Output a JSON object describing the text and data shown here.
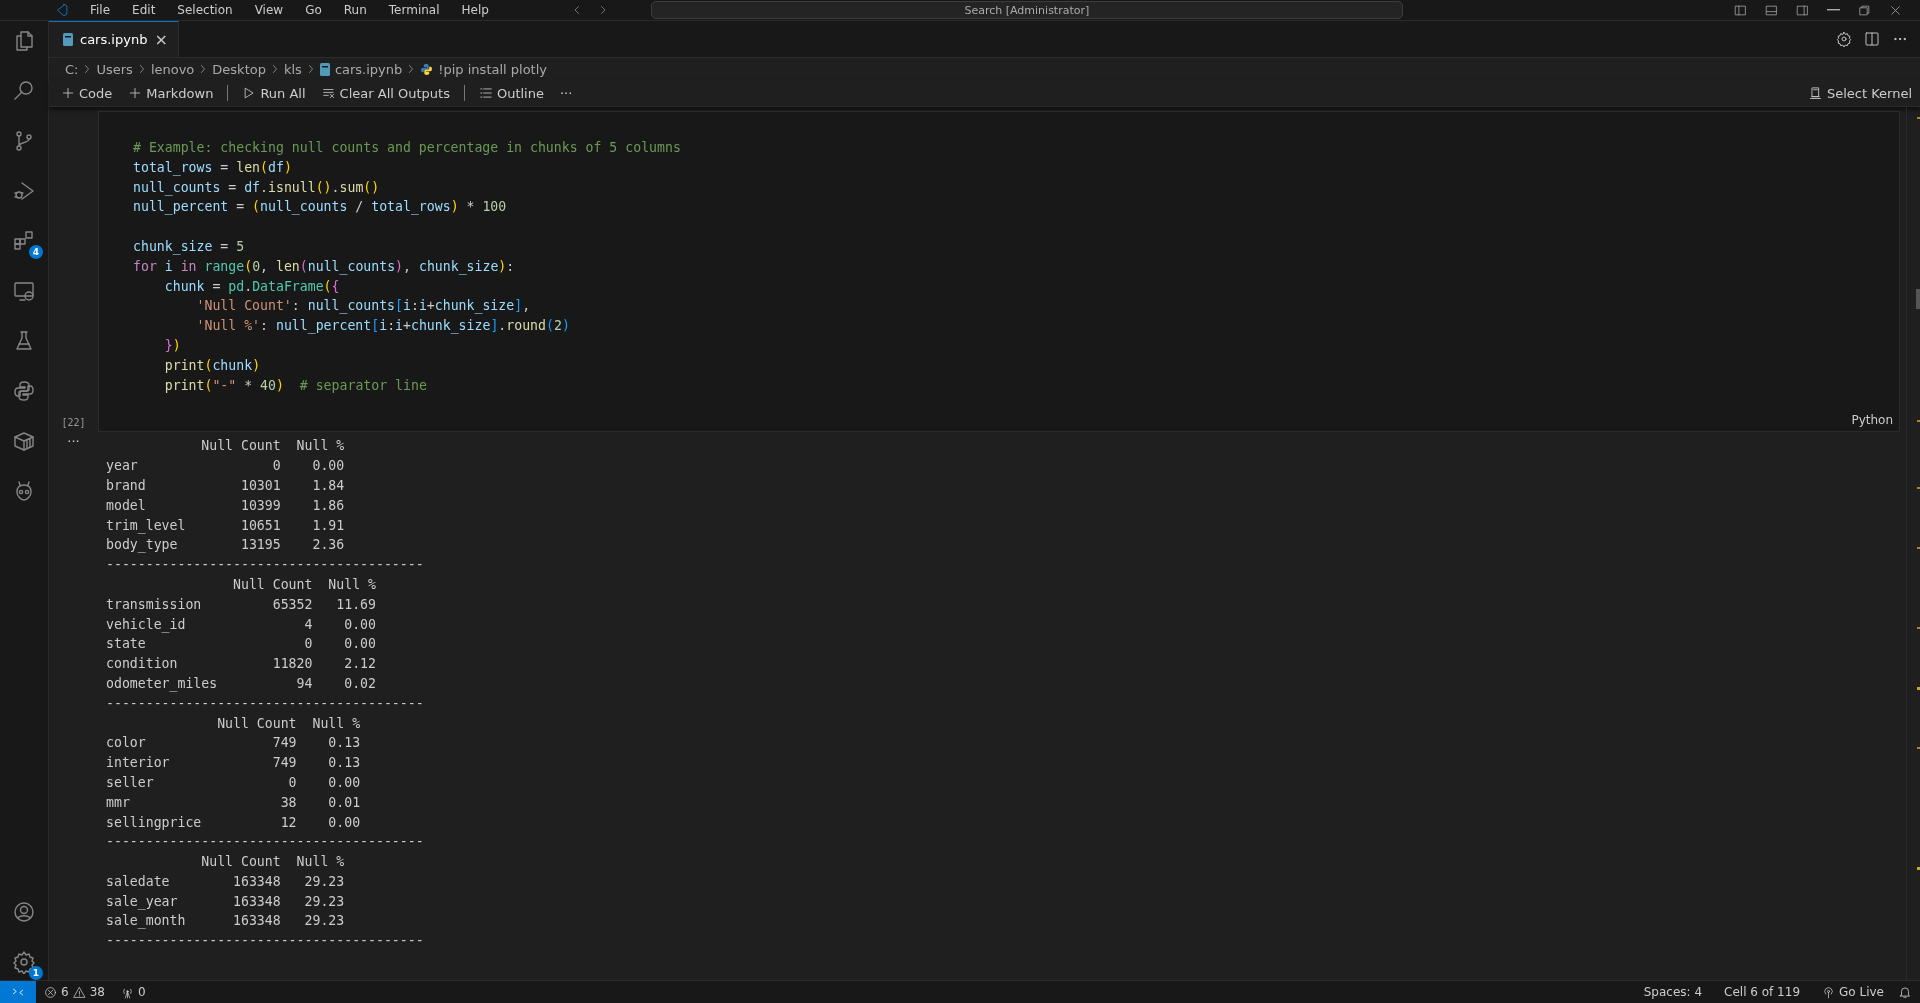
{
  "menu_bar": {
    "items": [
      "File",
      "Edit",
      "Selection",
      "View",
      "Go",
      "Run",
      "Terminal",
      "Help"
    ],
    "search": {
      "value": "Search [Administrator]"
    }
  },
  "activity_bar": {
    "top": [
      {
        "kind": "files"
      },
      {
        "kind": "search"
      },
      {
        "kind": "source-control"
      },
      {
        "kind": "run-debug"
      },
      {
        "kind": "extensions",
        "badge": "4"
      },
      {
        "kind": "remote"
      },
      {
        "kind": "testing"
      },
      {
        "kind": "python"
      },
      {
        "kind": "container"
      },
      {
        "kind": "alien"
      }
    ],
    "bottom": [
      {
        "kind": "account"
      },
      {
        "kind": "manage",
        "badge": "1"
      }
    ]
  },
  "tabs": [
    {
      "label": "cars.ipynb",
      "selected": true,
      "close": "×"
    }
  ],
  "breadcrumbs": [
    {
      "kind": "path",
      "label": "C:"
    },
    {
      "kind": "path",
      "label": "Users"
    },
    {
      "kind": "path",
      "label": "lenovo"
    },
    {
      "kind": "path",
      "label": "Desktop"
    },
    {
      "kind": "path",
      "label": "kls"
    },
    {
      "kind": "notebook",
      "label": "cars.ipynb"
    },
    {
      "kind": "python",
      "label": "!pip install plotly"
    }
  ],
  "toolbar": {
    "items": [
      {
        "kind": "add",
        "label": "Code"
      },
      {
        "kind": "add",
        "label": "Markdown"
      },
      {
        "kind": "run",
        "label": "Run All"
      },
      {
        "kind": "clear",
        "label": "Clear All Outputs"
      },
      {
        "kind": "outline",
        "label": "Outline"
      },
      {
        "kind": "more",
        "label": "···"
      }
    ],
    "kernel": "Select Kernel"
  },
  "cell": {
    "execution_count": "[22]",
    "language": "Python",
    "code": [
      [
        [
          {
            "kind": "comment",
            "text": "# Example: checking null counts and percentage in chunks of 5 columns"
          }
        ],
        [
          {
            "kind": "var",
            "text": "total_rows"
          },
          {
            "kind": "plain",
            "text": " = "
          },
          {
            "kind": "func",
            "text": "len"
          },
          {
            "kind": "bracket1",
            "text": "("
          },
          {
            "kind": "var",
            "text": "df"
          },
          {
            "kind": "bracket1",
            "text": ")"
          }
        ],
        [
          {
            "kind": "var",
            "text": "null_counts"
          },
          {
            "kind": "plain",
            "text": " = "
          },
          {
            "kind": "var",
            "text": "df"
          },
          {
            "kind": "plain",
            "text": "."
          },
          {
            "kind": "func",
            "text": "isnull"
          },
          {
            "kind": "bracket1",
            "text": "()"
          },
          {
            "kind": "plain",
            "text": "."
          },
          {
            "kind": "func",
            "text": "sum"
          },
          {
            "kind": "bracket1",
            "text": "()"
          }
        ],
        [
          {
            "kind": "var",
            "text": "null_percent"
          },
          {
            "kind": "plain",
            "text": " = "
          },
          {
            "kind": "bracket1",
            "text": "("
          },
          {
            "kind": "var",
            "text": "null_counts"
          },
          {
            "kind": "plain",
            "text": " / "
          },
          {
            "kind": "var",
            "text": "total_rows"
          },
          {
            "kind": "bracket1",
            "text": ")"
          },
          {
            "kind": "plain",
            "text": " * "
          },
          {
            "kind": "number",
            "text": "100"
          }
        ]
      ],
      [
        [
          {
            "kind": "var",
            "text": "chunk_size"
          },
          {
            "kind": "plain",
            "text": " = "
          },
          {
            "kind": "number",
            "text": "5"
          }
        ],
        [
          {
            "kind": "keyword",
            "text": "for "
          },
          {
            "kind": "var",
            "text": "i "
          },
          {
            "kind": "keyword",
            "text": "in "
          },
          {
            "kind": "class",
            "text": "range"
          },
          {
            "kind": "bracket1",
            "text": "("
          },
          {
            "kind": "number",
            "text": "0"
          },
          {
            "kind": "plain",
            "text": ", "
          },
          {
            "kind": "func",
            "text": "len"
          },
          {
            "kind": "bracket2",
            "text": "("
          },
          {
            "kind": "var",
            "text": "null_counts"
          },
          {
            "kind": "bracket2",
            "text": ")"
          },
          {
            "kind": "plain",
            "text": ", "
          },
          {
            "kind": "var",
            "text": "chunk_size"
          },
          {
            "kind": "bracket1",
            "text": ")"
          },
          {
            "kind": "plain",
            "text": ":"
          }
        ],
        [
          {
            "kind": "var",
            "text": "    chunk"
          },
          {
            "kind": "plain",
            "text": " = "
          },
          {
            "kind": "class",
            "text": "pd"
          },
          {
            "kind": "plain",
            "text": "."
          },
          {
            "kind": "class",
            "text": "DataFrame"
          },
          {
            "kind": "bracket1",
            "text": "("
          },
          {
            "kind": "bracket2",
            "text": "{"
          }
        ],
        [
          {
            "kind": "string",
            "text": "        'Null Count'"
          },
          {
            "kind": "plain",
            "text": ": "
          },
          {
            "kind": "var",
            "text": "null_counts"
          },
          {
            "kind": "bracket3",
            "text": "["
          },
          {
            "kind": "var",
            "text": "i"
          },
          {
            "kind": "plain",
            "text": ":"
          },
          {
            "kind": "var",
            "text": "i"
          },
          {
            "kind": "plain",
            "text": "+"
          },
          {
            "kind": "var",
            "text": "chunk_size"
          },
          {
            "kind": "bracket3",
            "text": "]"
          },
          {
            "kind": "plain",
            "text": ","
          }
        ],
        [
          {
            "kind": "string",
            "text": "        'Null %'"
          },
          {
            "kind": "plain",
            "text": ": "
          },
          {
            "kind": "var",
            "text": "null_percent"
          },
          {
            "kind": "bracket3",
            "text": "["
          },
          {
            "kind": "var",
            "text": "i"
          },
          {
            "kind": "plain",
            "text": ":"
          },
          {
            "kind": "var",
            "text": "i"
          },
          {
            "kind": "plain",
            "text": "+"
          },
          {
            "kind": "var",
            "text": "chunk_size"
          },
          {
            "kind": "bracket3",
            "text": "]"
          },
          {
            "kind": "plain",
            "text": "."
          },
          {
            "kind": "func",
            "text": "round"
          },
          {
            "kind": "bracket3",
            "text": "("
          },
          {
            "kind": "number",
            "text": "2"
          },
          {
            "kind": "bracket3",
            "text": ")"
          }
        ],
        [
          {
            "kind": "bracket2",
            "text": "    }"
          },
          {
            "kind": "bracket1",
            "text": ")"
          }
        ],
        [
          {
            "kind": "func",
            "text": "    print"
          },
          {
            "kind": "bracket1",
            "text": "("
          },
          {
            "kind": "var",
            "text": "chunk"
          },
          {
            "kind": "bracket1",
            "text": ")"
          }
        ],
        [
          {
            "kind": "func",
            "text": "    print"
          },
          {
            "kind": "bracket1",
            "text": "("
          },
          {
            "kind": "string",
            "text": "\"-\""
          },
          {
            "kind": "plain",
            "text": " * "
          },
          {
            "kind": "number",
            "text": "40"
          },
          {
            "kind": "bracket1",
            "text": ")"
          },
          {
            "kind": "comment",
            "text": "  # separator line"
          }
        ]
      ]
    ]
  },
  "output": {
    "more": "···",
    "tables": [
      {
        "columns": [
          "Null Count",
          "Null %"
        ],
        "separator": "----------------------------------------",
        "rows": [
          {
            "label": "year",
            "count": "0",
            "percent": "0.00"
          },
          {
            "label": "brand",
            "count": "10301",
            "percent": "1.84"
          },
          {
            "label": "model",
            "count": "10399",
            "percent": "1.86"
          },
          {
            "label": "trim_level",
            "count": "10651",
            "percent": "1.91"
          },
          {
            "label": "body_type",
            "count": "13195",
            "percent": "2.36"
          }
        ]
      },
      {
        "columns": [
          "Null Count",
          "Null %"
        ],
        "separator": "----------------------------------------",
        "rows": [
          {
            "label": "transmission",
            "count": "65352",
            "percent": "11.69"
          },
          {
            "label": "vehicle_id",
            "count": "4",
            "percent": "0.00"
          },
          {
            "label": "state",
            "count": "0",
            "percent": "0.00"
          },
          {
            "label": "condition",
            "count": "11820",
            "percent": "2.12"
          },
          {
            "label": "odometer_miles",
            "count": "94",
            "percent": "0.02"
          }
        ]
      },
      {
        "columns": [
          "Null Count",
          "Null %"
        ],
        "separator": "----------------------------------------",
        "rows": [
          {
            "label": "color",
            "count": "749",
            "percent": "0.13"
          },
          {
            "label": "interior",
            "count": "749",
            "percent": "0.13"
          },
          {
            "label": "seller",
            "count": "0",
            "percent": "0.00"
          },
          {
            "label": "mmr",
            "count": "38",
            "percent": "0.01"
          },
          {
            "label": "sellingprice",
            "count": "12",
            "percent": "0.00"
          }
        ]
      },
      {
        "columns": [
          "Null Count",
          "Null %"
        ],
        "separator": "----------------------------------------",
        "rows": [
          {
            "label": "saledate",
            "count": "163348",
            "percent": "29.23"
          },
          {
            "label": "sale_year",
            "count": "163348",
            "percent": "29.23"
          },
          {
            "label": "sale_month",
            "count": "163348",
            "percent": "29.23"
          }
        ]
      }
    ]
  },
  "status_bar": {
    "errors": "6",
    "warnings": "38",
    "ports": "0",
    "right": [
      {
        "kind": "text",
        "label": "Spaces: 4"
      },
      {
        "kind": "text",
        "label": "Cell 6 of 119"
      },
      {
        "kind": "live",
        "label": "Go Live"
      }
    ]
  }
}
